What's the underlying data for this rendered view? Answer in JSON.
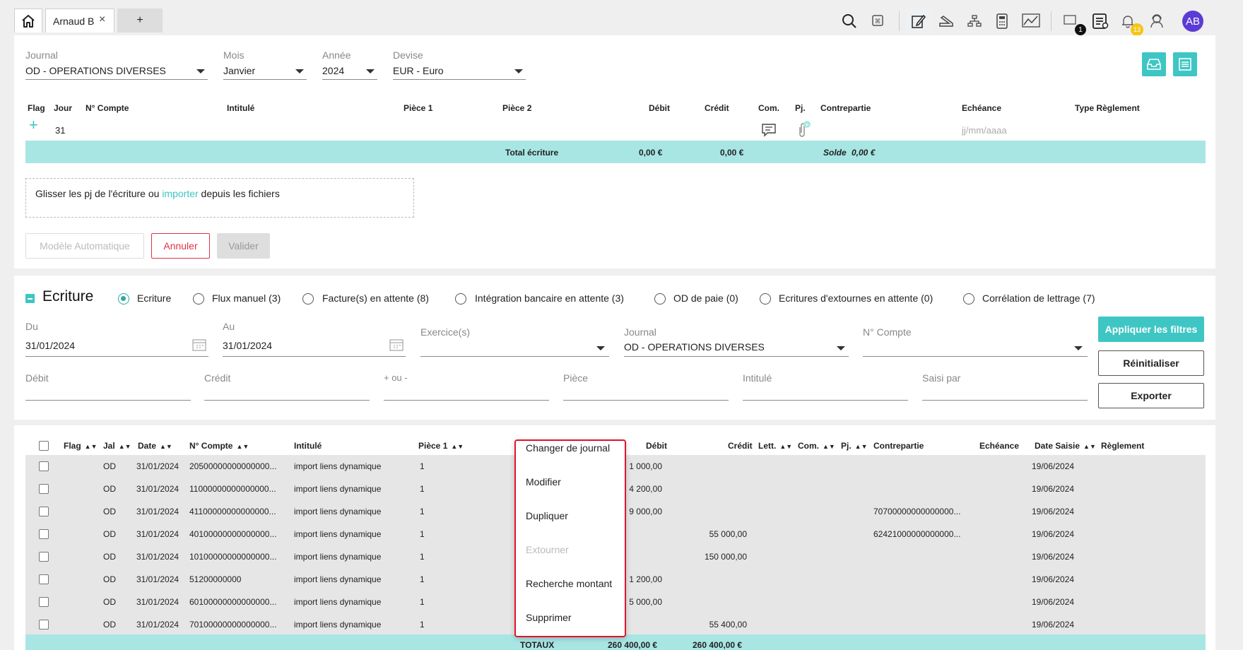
{
  "tabs": {
    "home_label": "",
    "active": "Arnaud B",
    "add": "+"
  },
  "toolbar": {
    "messages_badge": "1",
    "notifications_badge": "13",
    "avatar": "AB"
  },
  "entry_form": {
    "journal_label": "Journal",
    "journal_value": "OD - OPERATIONS DIVERSES",
    "mois_label": "Mois",
    "mois_value": "Janvier",
    "annee_label": "Année",
    "annee_value": "2024",
    "devise_label": "Devise",
    "devise_value": "EUR - Euro",
    "columns": [
      "Flag",
      "Jour",
      "N° Compte",
      "Intitulé",
      "Pièce 1",
      "Pièce 2",
      "Débit",
      "Crédit",
      "Com.",
      "Pj.",
      "Contrepartie",
      "Echéance",
      "Type Règlement"
    ],
    "row_jour": "31",
    "echeance_placeholder": "jj/mm/aaaa",
    "total_label": "Total écriture",
    "total_debit": "0,00 €",
    "total_credit": "0,00 €",
    "solde_label": "Solde",
    "solde_value": "0,00 €",
    "drop_text_before": "Glisser les pj de l'écriture ou ",
    "drop_link": "importer",
    "drop_text_after": " depuis les fichiers",
    "btn_modele": "Modèle Automatique",
    "btn_annuler": "Annuler",
    "btn_valider": "Valider"
  },
  "filters": {
    "section_title": "Ecriture",
    "radios": [
      {
        "label": "Ecriture",
        "selected": true
      },
      {
        "label": "Flux manuel (3)",
        "selected": false
      },
      {
        "label": "Facture(s) en attente (8)",
        "selected": false
      },
      {
        "label": "Intégration bancaire en attente (3)",
        "selected": false
      },
      {
        "label": "OD de paie (0)",
        "selected": false
      },
      {
        "label": "Ecritures d'extournes en attente (0)",
        "selected": false
      },
      {
        "label": "Corrélation de lettrage (7)",
        "selected": false
      }
    ],
    "du_label": "Du",
    "du_value": "31/01/2024",
    "au_label": "Au",
    "au_value": "31/01/2024",
    "exercice_label": "Exercice(s)",
    "journal_label": "Journal",
    "journal_value": "OD - OPERATIONS DIVERSES",
    "compte_label": "N° Compte",
    "debit_label": "Débit",
    "credit_label": "Crédit",
    "plusmoins_label": "+ ou -",
    "piece_label": "Pièce",
    "intitule_label": "Intitulé",
    "saisi_label": "Saisi par",
    "btn_appliquer": "Appliquer les filtres",
    "btn_reinit": "Réinitialiser",
    "btn_exporter": "Exporter"
  },
  "table": {
    "headers": {
      "flag": "Flag",
      "jal": "Jal",
      "date": "Date",
      "compte": "N° Compte",
      "intitule": "Intitulé",
      "piece1": "Pièce 1",
      "debit": "Débit",
      "credit": "Crédit",
      "lett": "Lett.",
      "com": "Com.",
      "pj": "Pj.",
      "contrepartie": "Contrepartie",
      "echeance": "Echéance",
      "date_saisie": "Date Saisie",
      "reglement": "Règlement"
    },
    "rows": [
      {
        "jal": "OD",
        "date": "31/01/2024",
        "compte": "20500000000000000...",
        "intitule": "import liens dynamique",
        "piece1": "1",
        "debit": "1 000,00",
        "credit": "",
        "contrepartie": "",
        "date_saisie": "19/06/2024"
      },
      {
        "jal": "OD",
        "date": "31/01/2024",
        "compte": "11000000000000000...",
        "intitule": "import liens dynamique",
        "piece1": "1",
        "debit": "4 200,00",
        "credit": "",
        "contrepartie": "",
        "date_saisie": "19/06/2024"
      },
      {
        "jal": "OD",
        "date": "31/01/2024",
        "compte": "41100000000000000...",
        "intitule": "import liens dynamique",
        "piece1": "1",
        "debit": "9 000,00",
        "credit": "",
        "contrepartie": "70700000000000000...",
        "date_saisie": "19/06/2024"
      },
      {
        "jal": "OD",
        "date": "31/01/2024",
        "compte": "40100000000000000...",
        "intitule": "import liens dynamique",
        "piece1": "1",
        "debit": "",
        "credit": "55 000,00",
        "contrepartie": "62421000000000000...",
        "date_saisie": "19/06/2024"
      },
      {
        "jal": "OD",
        "date": "31/01/2024",
        "compte": "10100000000000000...",
        "intitule": "import liens dynamique",
        "piece1": "1",
        "debit": "",
        "credit": "150 000,00",
        "contrepartie": "",
        "date_saisie": "19/06/2024"
      },
      {
        "jal": "OD",
        "date": "31/01/2024",
        "compte": "51200000000",
        "intitule": "import liens dynamique",
        "piece1": "1",
        "debit": "1 200,00",
        "credit": "",
        "contrepartie": "",
        "date_saisie": "19/06/2024"
      },
      {
        "jal": "OD",
        "date": "31/01/2024",
        "compte": "60100000000000000...",
        "intitule": "import liens dynamique",
        "piece1": "1",
        "debit": "5 000,00",
        "credit": "",
        "contrepartie": "",
        "date_saisie": "19/06/2024"
      },
      {
        "jal": "OD",
        "date": "31/01/2024",
        "compte": "70100000000000000...",
        "intitule": "import liens dynamique",
        "piece1": "1",
        "debit": "",
        "credit": "55 400,00",
        "contrepartie": "",
        "date_saisie": "19/06/2024"
      }
    ],
    "totals_label": "TOTAUX",
    "totals_debit": "260 400,00 €",
    "totals_credit": "260 400,00 €"
  },
  "context_menu": {
    "items": [
      {
        "label": "Changer de journal",
        "disabled": false
      },
      {
        "label": "Modifier",
        "disabled": false
      },
      {
        "label": "Dupliquer",
        "disabled": false
      },
      {
        "label": "Extourner",
        "disabled": true
      },
      {
        "label": "Recherche montant",
        "disabled": false
      },
      {
        "label": "Supprimer",
        "disabled": false
      }
    ]
  },
  "colors": {
    "accent": "#3ec6c4",
    "band": "#a8e6e4",
    "danger": "#e03345",
    "avatar": "#5b3bd6",
    "menu_border": "#e3142b"
  }
}
